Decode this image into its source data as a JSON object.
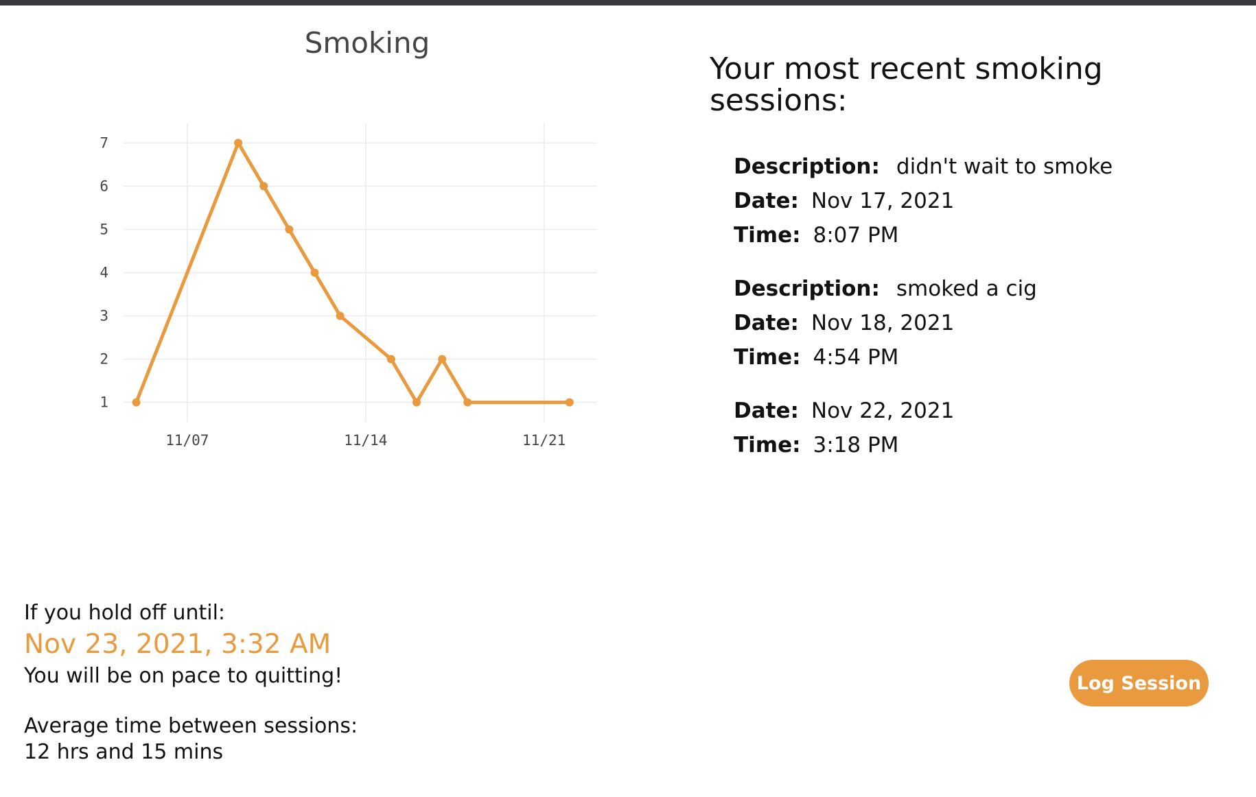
{
  "chart_data": {
    "type": "line",
    "title": "Smoking",
    "xlabel": "",
    "ylabel": "",
    "x_ticks": [
      "11/07",
      "11/14",
      "11/21"
    ],
    "y_ticks": [
      1,
      2,
      3,
      4,
      5,
      6,
      7
    ],
    "ylim": [
      0.55,
      7.45
    ],
    "grid": true,
    "series": [
      {
        "color": "#e99a3f",
        "points": [
          {
            "x": "2021-11-05",
            "y": 1
          },
          {
            "x": "2021-11-09",
            "y": 7
          },
          {
            "x": "2021-11-10",
            "y": 6
          },
          {
            "x": "2021-11-11",
            "y": 5
          },
          {
            "x": "2021-11-12",
            "y": 4
          },
          {
            "x": "2021-11-13",
            "y": 3
          },
          {
            "x": "2021-11-15",
            "y": 2
          },
          {
            "x": "2021-11-16",
            "y": 1
          },
          {
            "x": "2021-11-17",
            "y": 2
          },
          {
            "x": "2021-11-18",
            "y": 1
          },
          {
            "x": "2021-11-22",
            "y": 1
          }
        ]
      }
    ]
  },
  "sessions": {
    "heading": "Your most recent smoking sessions:",
    "description_label": "Description:",
    "date_label": "Date:",
    "time_label": "Time:",
    "items": [
      {
        "description": "didn't wait to smoke",
        "date": "Nov 17, 2021",
        "time": "8:07 PM"
      },
      {
        "description": "smoked a cig",
        "date": "Nov 18, 2021",
        "time": "4:54 PM"
      },
      {
        "date": "Nov 22, 2021",
        "time": "3:18 PM"
      }
    ]
  },
  "hold": {
    "label": "If you hold off until:",
    "date": "Nov 23, 2021, 3:32 AM",
    "message": "You will be on pace to quitting!",
    "average_label": "Average time between sessions:",
    "average_value": "12 hrs and 15 mins"
  },
  "actions": {
    "log_session": "Log Session"
  },
  "colors": {
    "accent": "#e99a3f",
    "top_bar": "#3a3b40"
  }
}
